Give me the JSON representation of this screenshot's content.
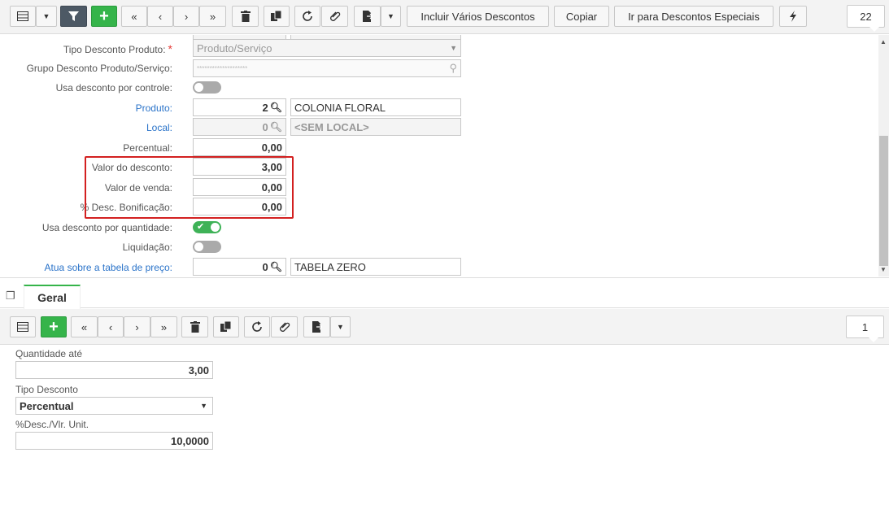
{
  "toolbar": {
    "incluir_label": "Incluir Vários Descontos",
    "copiar_label": "Copiar",
    "ir_label": "Ir para Descontos Especiais",
    "record_count": "22"
  },
  "form": {
    "tipo_desconto_produto": {
      "label": "Tipo Desconto Produto:",
      "value": "Produto/Serviço"
    },
    "grupo_desconto": {
      "label": "Grupo Desconto Produto/Serviço:",
      "value": "********************"
    },
    "usa_desconto_controle": {
      "label": "Usa desconto por controle:"
    },
    "produto": {
      "label": "Produto:",
      "code": "2",
      "name": "COLONIA FLORAL"
    },
    "local": {
      "label": "Local:",
      "code": "0",
      "name": "<SEM LOCAL>"
    },
    "percentual": {
      "label": "Percentual:",
      "value": "0,00"
    },
    "valor_desconto": {
      "label": "Valor do desconto:",
      "value": "3,00"
    },
    "valor_venda": {
      "label": "Valor de venda:",
      "value": "0,00"
    },
    "desc_bonificacao": {
      "label": "% Desc. Bonificação:",
      "value": "0,00"
    },
    "usa_desconto_quantidade": {
      "label": "Usa desconto por quantidade:"
    },
    "liquidacao": {
      "label": "Liquidação:"
    },
    "tabela_preco": {
      "label": "Atua sobre a tabela de preço:",
      "code": "0",
      "name": "TABELA ZERO"
    }
  },
  "tabs": [
    {
      "label": "Geral"
    }
  ],
  "toolbar2": {
    "record_count": "1"
  },
  "detail": {
    "quantidade_ate": {
      "label": "Quantidade até",
      "value": "3,00"
    },
    "tipo_desconto": {
      "label": "Tipo Desconto",
      "value": "Percentual"
    },
    "desc_vlr_unit": {
      "label": "%Desc./Vlr. Unit.",
      "value": "10,0000"
    }
  }
}
